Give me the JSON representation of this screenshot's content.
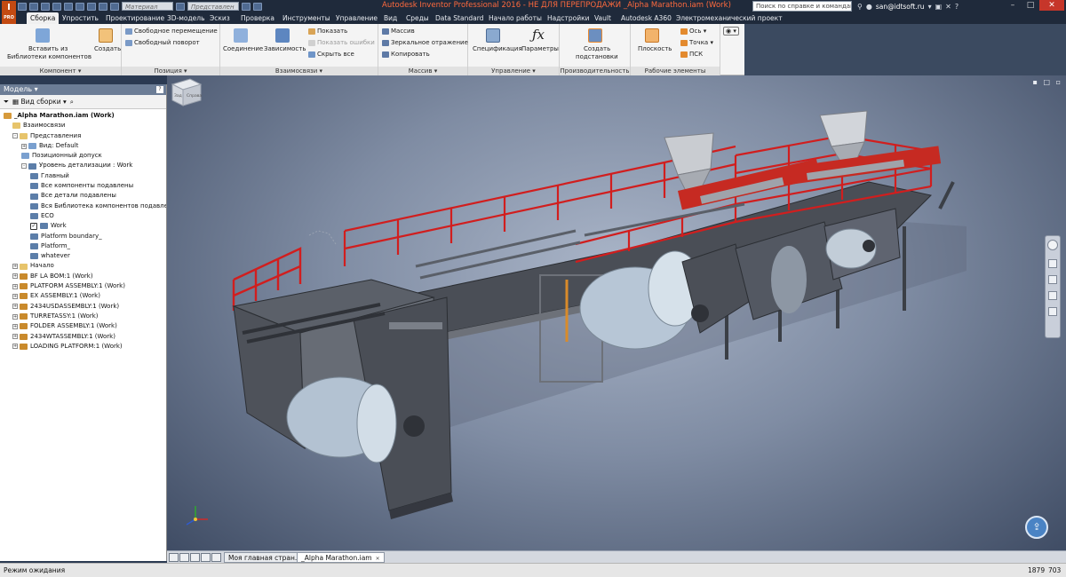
{
  "app": {
    "logo_letter": "I",
    "logo_sub": "PRO",
    "window_title": "Autodesk Inventor Professional 2016 - НЕ ДЛЯ ПЕРЕПРОДАЖИ   _Alpha Marathon.iam (Work)",
    "material_placeholder": "Материал",
    "appearance_placeholder": "Представлен",
    "help_search_placeholder": "Поиск по справке и командам",
    "user": "san@idtsoft.ru",
    "accent_color": "#c34a12",
    "title_color": "#ff6a3d"
  },
  "tabs": [
    {
      "label": "Сборка",
      "active": true
    },
    {
      "label": "Упростить"
    },
    {
      "label": "Проектирование"
    },
    {
      "label": "3D-модель"
    },
    {
      "label": "Эскиз"
    },
    {
      "label": "Проверка"
    },
    {
      "label": "Инструменты"
    },
    {
      "label": "Управление"
    },
    {
      "label": "Вид"
    },
    {
      "label": "Среды"
    },
    {
      "label": "Data Standard"
    },
    {
      "label": "Начало работы"
    },
    {
      "label": "Надстройки"
    },
    {
      "label": "Vault"
    },
    {
      "label": "Autodesk A360"
    },
    {
      "label": "Электромеханический проект"
    }
  ],
  "ribbon": {
    "component": {
      "footer": "Компонент",
      "insert_label_1": "Вставить из",
      "insert_label_2": "Библиотеки компонентов",
      "create_label": "Создать"
    },
    "position": {
      "footer": "Позиция",
      "free_move": "Свободное перемещение",
      "free_rotate": "Свободный поворот"
    },
    "relations": {
      "footer": "Взаимосвязи",
      "joint": "Соединение",
      "constrain": "Зависимость",
      "show": "Показать",
      "show_errors": "Показать ошибки",
      "hide_all": "Скрыть все"
    },
    "pattern": {
      "footer": "Массив",
      "pattern": "Массив",
      "mirror": "Зеркальное отражение",
      "copy": "Копировать"
    },
    "manage": {
      "footer": "Управление",
      "bom": "Спецификация",
      "params": "Параметры"
    },
    "productivity": {
      "footer": "Производительность",
      "create_sub_1": "Создать",
      "create_sub_2": "подстановки"
    },
    "work_features": {
      "footer": "Рабочие элементы",
      "plane": "Плоскость",
      "axis": "Ось",
      "point": "Точка",
      "ucs": "ПСК"
    }
  },
  "browser": {
    "title": "Модель",
    "view_label": "Вид сборки",
    "nodes": [
      {
        "label": "_Alpha Marathon.iam (Work)",
        "indent": 0,
        "bold": true,
        "icon": "assembly-icon"
      },
      {
        "label": "Взаимосвязи",
        "indent": 1,
        "icon": "folder-icon"
      },
      {
        "label": "Представления",
        "indent": 1,
        "icon": "folder-icon",
        "expand": "-"
      },
      {
        "label": "Вид: Default",
        "indent": 2,
        "icon": "view-icon",
        "expand": "+"
      },
      {
        "label": "Позиционный допуск",
        "indent": 2,
        "icon": "view-icon"
      },
      {
        "label": "Уровень детализации : Work",
        "indent": 2,
        "icon": "lod-icon",
        "expand": "-"
      },
      {
        "label": "Главный",
        "indent": 3,
        "icon": "lod-icon"
      },
      {
        "label": "Все компоненты подавлены",
        "indent": 3,
        "icon": "lod-icon"
      },
      {
        "label": "Все детали подавлены",
        "indent": 3,
        "icon": "lod-icon"
      },
      {
        "label": "Вся Библиотека компонентов подавлена",
        "indent": 3,
        "icon": "lod-icon"
      },
      {
        "label": "ECO",
        "indent": 3,
        "icon": "lod-icon"
      },
      {
        "label": "Work",
        "indent": 3,
        "icon": "lod-icon",
        "checked": true
      },
      {
        "label": "Platform boundary_",
        "indent": 3,
        "icon": "lod-icon"
      },
      {
        "label": "Platform_",
        "indent": 3,
        "icon": "lod-icon"
      },
      {
        "label": "whatever",
        "indent": 3,
        "icon": "lod-icon"
      },
      {
        "label": "Начало",
        "indent": 1,
        "icon": "folder-icon",
        "expand": "+"
      },
      {
        "label": "BF LA BOM:1 (Work)",
        "indent": 1,
        "icon": "subassembly-icon",
        "expand": "+"
      },
      {
        "label": "PLATFORM ASSEMBLY:1 (Work)",
        "indent": 1,
        "icon": "subassembly-icon",
        "expand": "+"
      },
      {
        "label": "EX ASSEMBLY:1 (Work)",
        "indent": 1,
        "icon": "subassembly-icon",
        "expand": "+"
      },
      {
        "label": "2434USDASSEMBLY:1 (Work)",
        "indent": 1,
        "icon": "subassembly-icon",
        "expand": "+"
      },
      {
        "label": "TURRETASSY:1 (Work)",
        "indent": 1,
        "icon": "subassembly-icon",
        "expand": "+"
      },
      {
        "label": "FOLDER ASSEMBLY:1 (Work)",
        "indent": 1,
        "icon": "subassembly-icon",
        "expand": "+"
      },
      {
        "label": "2434WTASSEMBLY:1 (Work)",
        "indent": 1,
        "icon": "subassembly-icon",
        "expand": "+"
      },
      {
        "label": "LOADING PLATFORM:1 (Work)",
        "indent": 1,
        "icon": "subassembly-icon",
        "expand": "+"
      }
    ]
  },
  "viewcube": {
    "front": "Зад",
    "side": "Справа"
  },
  "doc_tabs": [
    {
      "label": "Моя главная стран...",
      "active": false
    },
    {
      "label": "_Alpha Marathon.iam",
      "active": true
    }
  ],
  "status": {
    "text": "Режим ожидания",
    "n1": "1879",
    "n2": "703"
  }
}
